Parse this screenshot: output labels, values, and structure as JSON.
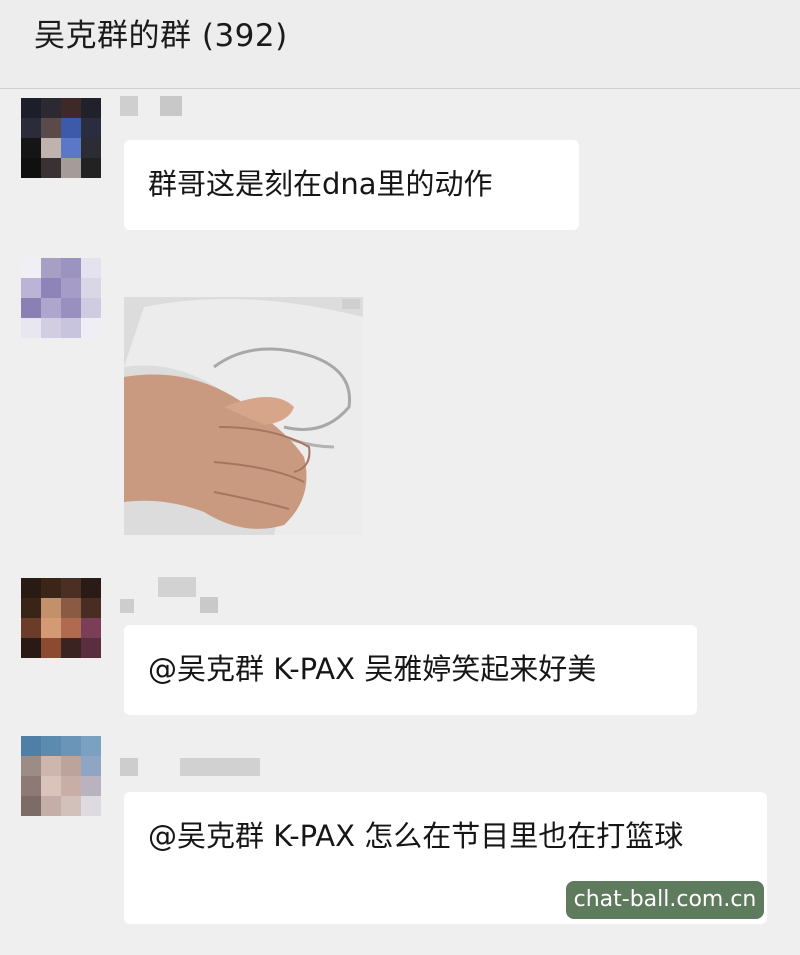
{
  "header": {
    "title": "吴克群的群 (392)"
  },
  "messages": [
    {
      "type": "text",
      "text": "群哥这是刻在dna里的动作"
    },
    {
      "type": "image",
      "image_caption": ""
    },
    {
      "type": "text",
      "text": "@吴克群 K-PAX 吴雅婷笑起来好美"
    },
    {
      "type": "text",
      "text": "@吴克群 K-PAX 怎么在节目里也在打篮球"
    }
  ],
  "watermark": "chat-ball.com.cn",
  "colors": {
    "background": "#efefef",
    "bubble": "#ffffff",
    "watermark_bg": "#5f7b5e"
  }
}
